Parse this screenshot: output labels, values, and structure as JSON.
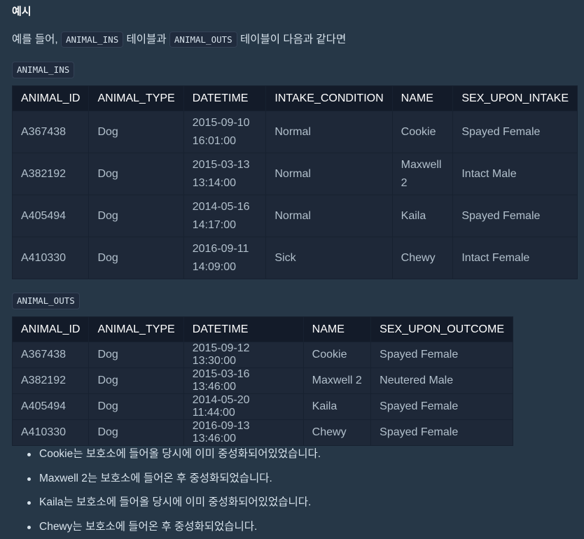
{
  "heading": "예시",
  "intro": {
    "part1": "예를 들어, ",
    "code1": "ANIMAL_INS",
    "part2": " 테이블과 ",
    "code2": "ANIMAL_OUTS",
    "part3": " 테이블이 다음과 같다면"
  },
  "ins": {
    "label": "ANIMAL_INS",
    "headers": [
      "ANIMAL_ID",
      "ANIMAL_TYPE",
      "DATETIME",
      "INTAKE_CONDITION",
      "NAME",
      "SEX_UPON_INTAKE"
    ],
    "rows": [
      {
        "id": "A367438",
        "type": "Dog",
        "date": "2015-09-10",
        "time": "16:01:00",
        "condition": "Normal",
        "name1": "Cookie",
        "name2": "",
        "sex": "Spayed Female"
      },
      {
        "id": "A382192",
        "type": "Dog",
        "date": "2015-03-13",
        "time": "13:14:00",
        "condition": "Normal",
        "name1": "Maxwell",
        "name2": "2",
        "sex": "Intact Male"
      },
      {
        "id": "A405494",
        "type": "Dog",
        "date": "2014-05-16",
        "time": "14:17:00",
        "condition": "Normal",
        "name1": "Kaila",
        "name2": "",
        "sex": "Spayed Female"
      },
      {
        "id": "A410330",
        "type": "Dog",
        "date": "2016-09-11",
        "time": "14:09:00",
        "condition": "Sick",
        "name1": "Chewy",
        "name2": "",
        "sex": "Intact Female"
      }
    ]
  },
  "outs": {
    "label": "ANIMAL_OUTS",
    "headers": [
      "ANIMAL_ID",
      "ANIMAL_TYPE",
      "DATETIME",
      "NAME",
      "SEX_UPON_OUTCOME"
    ],
    "rows": [
      {
        "id": "A367438",
        "type": "Dog",
        "datetime": "2015-09-12 13:30:00",
        "name": "Cookie",
        "sex": "Spayed Female"
      },
      {
        "id": "A382192",
        "type": "Dog",
        "datetime": "2015-03-16 13:46:00",
        "name": "Maxwell 2",
        "sex": "Neutered Male"
      },
      {
        "id": "A405494",
        "type": "Dog",
        "datetime": "2014-05-20 11:44:00",
        "name": "Kaila",
        "sex": "Spayed Female"
      },
      {
        "id": "A410330",
        "type": "Dog",
        "datetime": "2016-09-13 13:46:00",
        "name": "Chewy",
        "sex": "Spayed Female"
      }
    ]
  },
  "notes": [
    "Cookie는 보호소에 들어올 당시에 이미 중성화되어있었습니다.",
    "Maxwell 2는 보호소에 들어온 후 중성화되었습니다.",
    "Kaila는 보호소에 들어올 당시에 이미 중성화되어있었습니다.",
    "Chewy는 보호소에 들어온 후 중성화되었습니다."
  ],
  "colors": {
    "background": "#263747",
    "table_body": "#1e2838",
    "table_header": "#131b29",
    "text": "#d7e2eb",
    "cell_text": "#b2c0cc"
  }
}
